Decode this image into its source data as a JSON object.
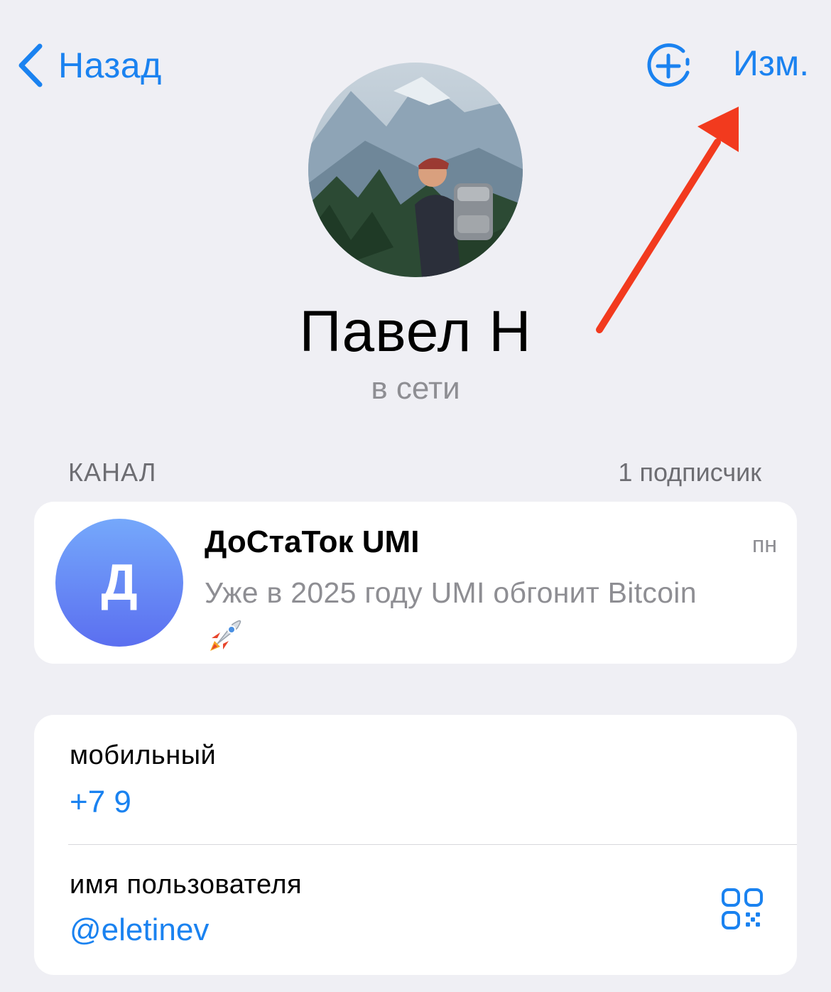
{
  "nav": {
    "back_label": "Назад",
    "edit_label": "Изм.",
    "accent_color": "#1a82f0"
  },
  "profile": {
    "name": "Павел Н",
    "status": "в сети"
  },
  "channel_section": {
    "title": "КАНАЛ",
    "subscribers": "1 подписчик"
  },
  "channel": {
    "avatar_letter": "Д",
    "name": "ДоСтаТок UMI",
    "date": "пн",
    "preview": "Уже в 2025 году UMI обгонит Bitcoin",
    "preview_emoji": "rocket-icon"
  },
  "info": {
    "mobile_label": "мобильный",
    "mobile_value": "+7 9",
    "username_label": "имя пользователя",
    "username_value": "@eletinev"
  },
  "annotation_color": "#f23a1e"
}
